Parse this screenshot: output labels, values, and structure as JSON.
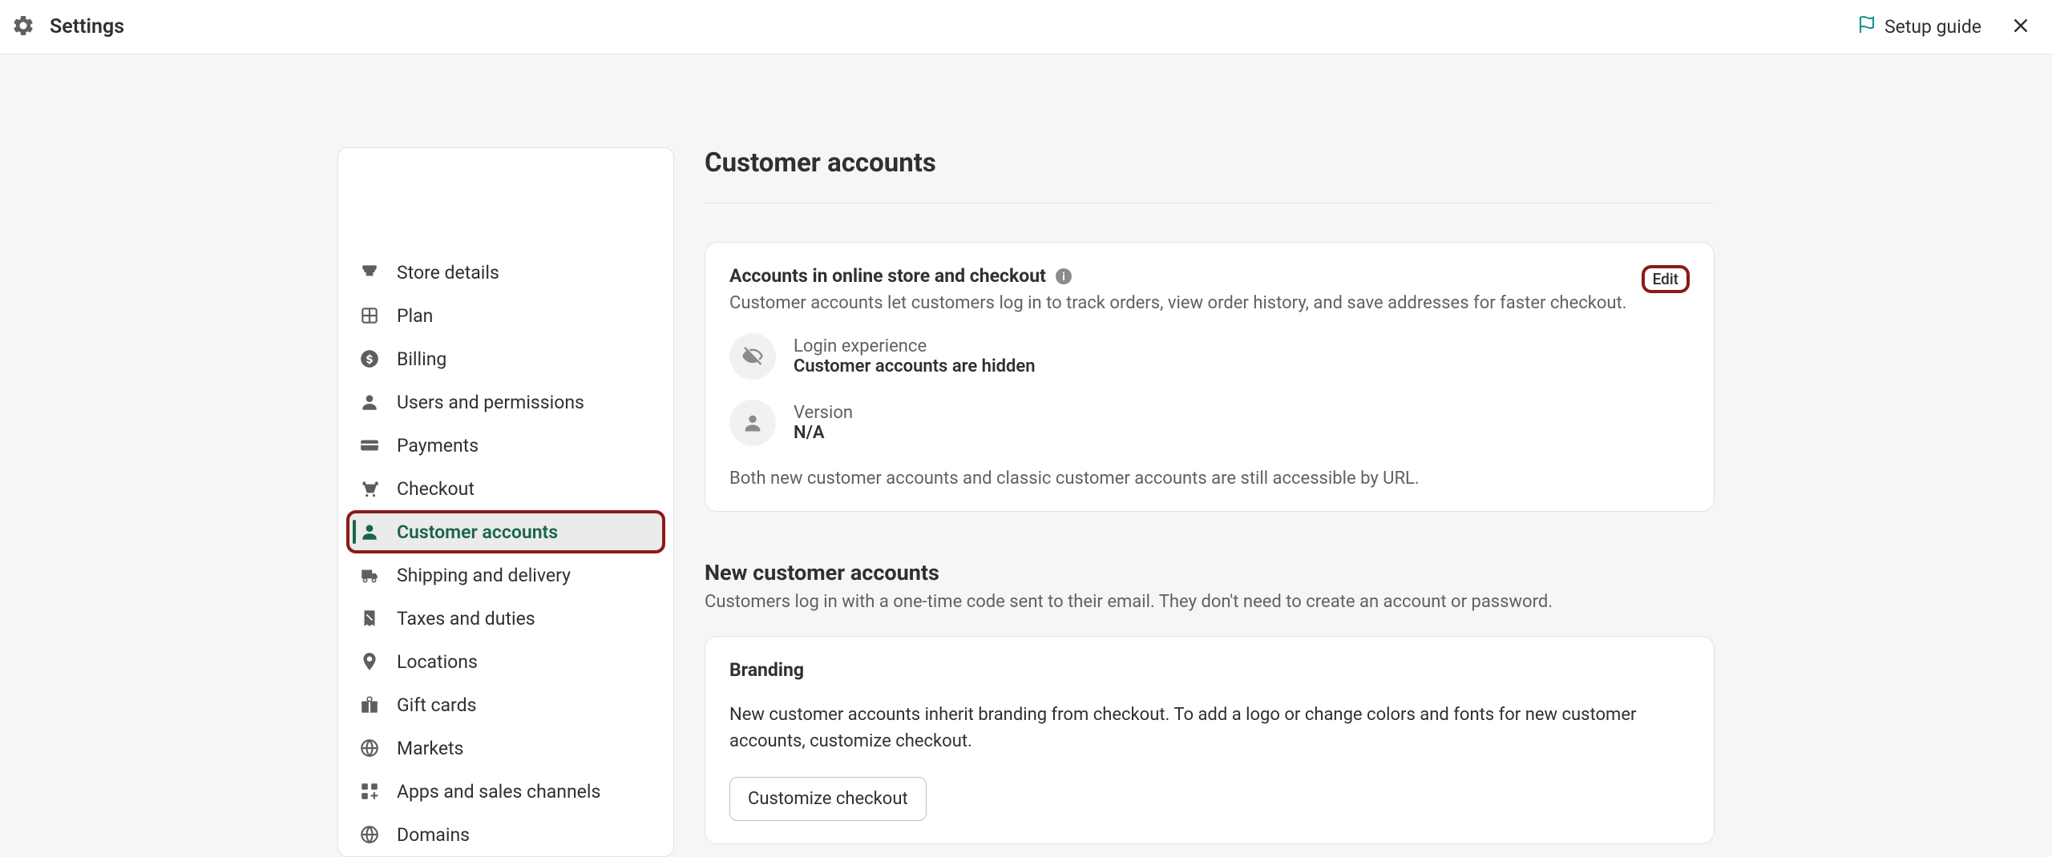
{
  "header": {
    "title": "Settings",
    "setup_guide": "Setup guide"
  },
  "sidebar": {
    "items": [
      {
        "label": "Store details",
        "icon": "store"
      },
      {
        "label": "Plan",
        "icon": "plan"
      },
      {
        "label": "Billing",
        "icon": "billing"
      },
      {
        "label": "Users and permissions",
        "icon": "users"
      },
      {
        "label": "Payments",
        "icon": "payments"
      },
      {
        "label": "Checkout",
        "icon": "checkout"
      },
      {
        "label": "Customer accounts",
        "icon": "customer",
        "active": true
      },
      {
        "label": "Shipping and delivery",
        "icon": "shipping"
      },
      {
        "label": "Taxes and duties",
        "icon": "taxes"
      },
      {
        "label": "Locations",
        "icon": "locations"
      },
      {
        "label": "Gift cards",
        "icon": "giftcards"
      },
      {
        "label": "Markets",
        "icon": "markets"
      },
      {
        "label": "Apps and sales channels",
        "icon": "apps"
      },
      {
        "label": "Domains",
        "icon": "domains"
      }
    ]
  },
  "page": {
    "title": "Customer accounts"
  },
  "accounts_card": {
    "title": "Accounts in online store and checkout",
    "subtitle": "Customer accounts let customers log in to track orders, view order history, and save addresses for faster checkout.",
    "edit_label": "Edit",
    "login_label": "Login experience",
    "login_value": "Customer accounts are hidden",
    "version_label": "Version",
    "version_value": "N/A",
    "footer_note": "Both new customer accounts and classic customer accounts are still accessible by URL."
  },
  "new_accounts": {
    "title": "New customer accounts",
    "subtitle": "Customers log in with a one-time code sent to their email. They don't need to create an account or password."
  },
  "branding": {
    "title": "Branding",
    "text": "New customer accounts inherit branding from checkout. To add a logo or change colors and fonts for new customer accounts, customize checkout.",
    "button": "Customize checkout"
  }
}
